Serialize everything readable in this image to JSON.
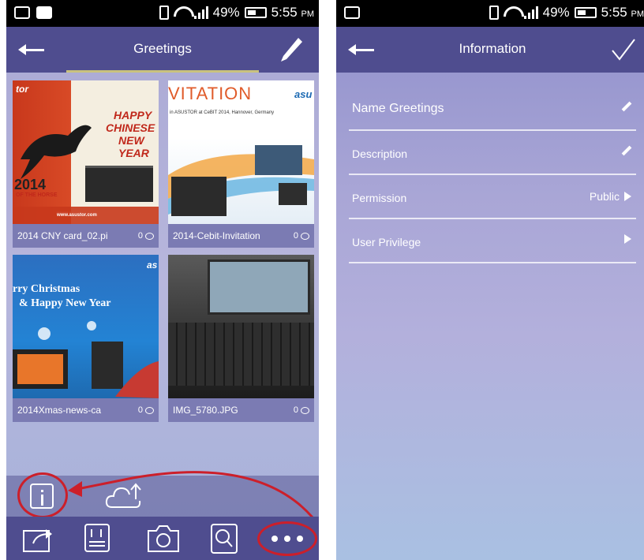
{
  "status_bar": {
    "battery": "49%",
    "time": "5:55",
    "ampm": "PM"
  },
  "gallery": {
    "title": "Greetings",
    "items": [
      {
        "name": "2014 CNY card_02.pi",
        "comments": "0"
      },
      {
        "name": "2014-Cebit-Invitation",
        "comments": "0"
      },
      {
        "name": "2014Xmas-news-ca",
        "comments": "0"
      },
      {
        "name": "IMG_5780.JPG",
        "comments": "0"
      }
    ],
    "image_text": {
      "cny_brand": "tor",
      "cny_line1": "HAPPY",
      "cny_line2": "CHINESE",
      "cny_line3": "NEW",
      "cny_line4": "YEAR",
      "cny_year": "2014",
      "cny_horse": "OF THE HORSE",
      "cny_url": "www.asustor.com",
      "cebit_head": "VITATION",
      "cebit_brand": "asu",
      "cebit_sub": "in ASUSTOR at CeBIT 2014, Hannover, Germany",
      "xmas_line1": "rry Christmas",
      "xmas_line2": "& Happy New Year",
      "xmas_brand": "as"
    }
  },
  "information": {
    "title": "Information",
    "rows": [
      {
        "label": "Name Greetings",
        "value": ""
      },
      {
        "label": "Description",
        "value": ""
      },
      {
        "label": "Permission",
        "value": "Public"
      },
      {
        "label": "User Privilege",
        "value": ""
      }
    ]
  },
  "colors": {
    "app_bar": "#4f4d8f",
    "highlight_ring": "#cc1f2a",
    "tab_underline": "#c9c27e"
  },
  "icons": {
    "toolbar_top": [
      "info-icon",
      "cloud-upload-icon"
    ],
    "toolbar_bottom": [
      "share-icon",
      "sort-icon",
      "camera-icon",
      "search-icon",
      "more-icon"
    ]
  }
}
